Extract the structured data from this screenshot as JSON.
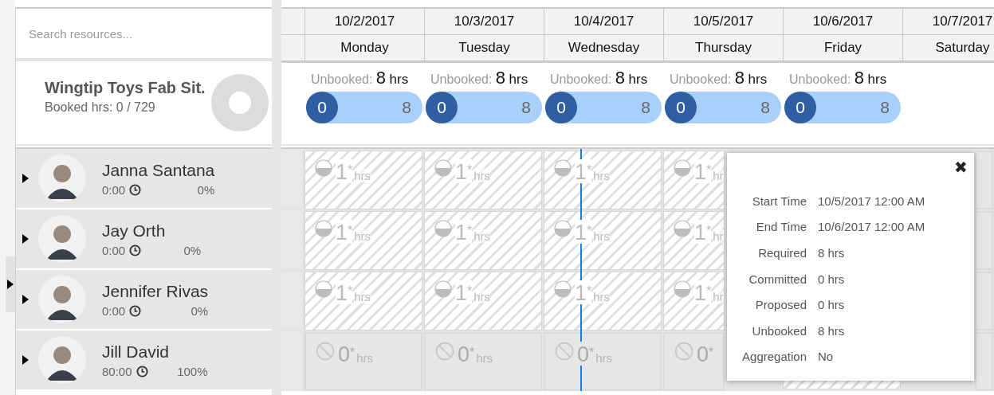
{
  "search": {
    "placeholder": "Search resources..."
  },
  "columns": [
    {
      "date": "10/2/2017",
      "day": "Monday"
    },
    {
      "date": "10/3/2017",
      "day": "Tuesday"
    },
    {
      "date": "10/4/2017",
      "day": "Wednesday"
    },
    {
      "date": "10/5/2017",
      "day": "Thursday"
    },
    {
      "date": "10/6/2017",
      "day": "Friday"
    },
    {
      "date": "10/7/2017",
      "day": "Saturday"
    }
  ],
  "summary": {
    "title": "Wingtip Toys Fab Sit.",
    "booked": "Booked hrs: 0 / 729",
    "days": [
      {
        "label": "Unbooked:",
        "value": "8",
        "unit": "hrs",
        "booked": "0",
        "capacity": "8"
      },
      {
        "label": "Unbooked:",
        "value": "8",
        "unit": "hrs",
        "booked": "0",
        "capacity": "8"
      },
      {
        "label": "Unbooked:",
        "value": "8",
        "unit": "hrs",
        "booked": "0",
        "capacity": "8"
      },
      {
        "label": "Unbooked:",
        "value": "8",
        "unit": "hrs",
        "booked": "0",
        "capacity": "8"
      },
      {
        "label": "Unbooked:",
        "value": "8",
        "unit": "hrs",
        "booked": "0",
        "capacity": "8"
      }
    ]
  },
  "resources": [
    {
      "name": "Janna Santana",
      "time": "0:00",
      "percent": "0%",
      "cells": [
        {
          "kind": "partial",
          "value": "1$^{*}$",
          "unit": "hrs"
        },
        {
          "kind": "partial",
          "value": "1$^{*}$",
          "unit": "hrs"
        },
        {
          "kind": "partial",
          "value": "1$^{*}$",
          "unit": "hrs"
        },
        {
          "kind": "partial",
          "value": "1$^{*}$",
          "unit": "hr"
        },
        {
          "kind": "empty"
        }
      ]
    },
    {
      "name": "Jay Orth",
      "time": "0:00",
      "percent": "0%",
      "cells": [
        {
          "kind": "partial",
          "value": "1$^{*}$",
          "unit": "hrs"
        },
        {
          "kind": "partial",
          "value": "1$^{*}$",
          "unit": "hrs"
        },
        {
          "kind": "partial",
          "value": "1$^{*}$",
          "unit": "hrs"
        },
        {
          "kind": "partial",
          "value": "1$^{*}$",
          "unit": "hr"
        },
        {
          "kind": "empty"
        }
      ]
    },
    {
      "name": "Jennifer Rivas",
      "time": "0:00",
      "percent": "0%",
      "cells": [
        {
          "kind": "partial",
          "value": "1$^{*}$",
          "unit": "hrs"
        },
        {
          "kind": "partial",
          "value": "1$^{*}$",
          "unit": "hrs"
        },
        {
          "kind": "partial",
          "value": "1$^{*}$",
          "unit": "hrs"
        },
        {
          "kind": "partial",
          "value": "1$^{*}$",
          "unit": "hr"
        },
        {
          "kind": "empty"
        }
      ]
    },
    {
      "name": "Jill David",
      "time": "80:00",
      "percent": "100%",
      "cells": [
        {
          "kind": "blocked",
          "value": "0$^{*}$",
          "unit": "hrs"
        },
        {
          "kind": "blocked",
          "value": "0$^{*}$",
          "unit": "hrs"
        },
        {
          "kind": "blocked",
          "value": "0$^{*}$",
          "unit": "hrs"
        },
        {
          "kind": "blocked",
          "value": "0$^{*}$"
        },
        {
          "kind": "hatched"
        },
        {
          "kind": "empty"
        }
      ]
    }
  ],
  "popup": {
    "close": "✖",
    "rows": [
      {
        "label": "Start Time",
        "value": "10/5/2017 12:00 AM"
      },
      {
        "label": "End Time",
        "value": "10/6/2017 12:00 AM"
      },
      {
        "label": "Required",
        "value": "8 hrs"
      },
      {
        "label": "Committed",
        "value": "0 hrs"
      },
      {
        "label": "Proposed",
        "value": "0 hrs"
      },
      {
        "label": "Unbooked",
        "value": "8 hrs"
      },
      {
        "label": "Aggregation",
        "value": "No"
      }
    ]
  }
}
